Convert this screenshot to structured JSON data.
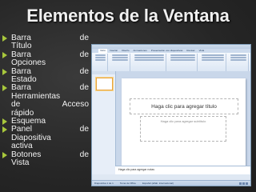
{
  "slide_title": "Elementos de la Ventana",
  "bullets": [
    {
      "lines": [
        [
          "Barra",
          "de"
        ],
        [
          "Título"
        ]
      ]
    },
    {
      "lines": [
        [
          "Barra",
          "de"
        ],
        [
          "Opciones"
        ]
      ]
    },
    {
      "lines": [
        [
          "Barra",
          "de"
        ],
        [
          "Estado"
        ]
      ]
    },
    {
      "lines": [
        [
          "Barra",
          "de"
        ],
        [
          "Herramientas"
        ],
        [
          "de",
          "Acceso"
        ],
        [
          "rápido"
        ]
      ]
    },
    {
      "lines": [
        [
          "Esquema"
        ]
      ]
    },
    {
      "lines": [
        [
          "Panel",
          "de"
        ],
        [
          "Diapositiva"
        ],
        [
          "activa"
        ]
      ]
    },
    {
      "lines": [
        [
          "Botones",
          "de"
        ],
        [
          "Vista"
        ]
      ]
    }
  ],
  "ppt": {
    "tabs": [
      "Inicio",
      "Insertar",
      "Diseño",
      "Animaciones",
      "Presentación con diapositivas",
      "Revisar",
      "Vista"
    ],
    "slide_title_placeholder": "Haga clic para agregar título",
    "slide_subtitle_placeholder": "Haga clic para agregar subtítulo",
    "notes_placeholder": "Haga clic para agregar notas",
    "status_items": [
      "Diapositiva 1 de 1",
      "Tema de Office",
      "Español (alfab. internacional)"
    ]
  },
  "colors": {
    "bullet": "#a8c83c",
    "background": "#2b2b2b"
  }
}
